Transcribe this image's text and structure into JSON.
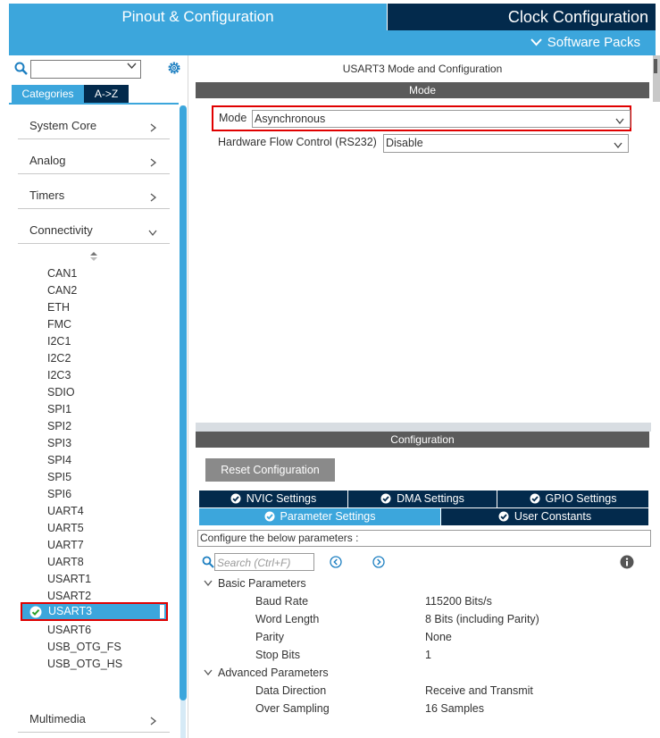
{
  "header": {
    "pinout_title": "Pinout & Configuration",
    "clock_title": "Clock Configuration",
    "software_packs": "Software Packs"
  },
  "sidebar": {
    "tabs": {
      "categories": "Categories",
      "az": "A->Z"
    },
    "categories": [
      "System Core",
      "Analog",
      "Timers",
      "Connectivity"
    ],
    "bottom_category": "Multimedia",
    "peripherals": [
      "CAN1",
      "CAN2",
      "ETH",
      "FMC",
      "I2C1",
      "I2C2",
      "I2C3",
      "SDIO",
      "SPI1",
      "SPI2",
      "SPI3",
      "SPI4",
      "SPI5",
      "SPI6",
      "UART4",
      "UART5",
      "UART7",
      "UART8",
      "USART1",
      "USART2"
    ],
    "selected_peripheral": "USART3",
    "peripherals_after": [
      "USART6",
      "USB_OTG_FS",
      "USB_OTG_HS"
    ]
  },
  "mode_panel": {
    "title": "USART3 Mode and Configuration",
    "header": "Mode",
    "mode_label": "Mode",
    "mode_value": "Asynchronous",
    "hfc_label": "Hardware Flow Control (RS232)",
    "hfc_value": "Disable"
  },
  "config_panel": {
    "header": "Configuration",
    "reset_button": "Reset Configuration",
    "tabs": {
      "nvic": "NVIC Settings",
      "dma": "DMA Settings",
      "gpio": "GPIO Settings",
      "parameter": "Parameter Settings",
      "user_constants": "User Constants"
    },
    "configure_text": "Configure the below parameters :",
    "search_placeholder": "Search (Ctrl+F)",
    "basic_group": "Basic Parameters",
    "basic_params": [
      {
        "name": "Baud Rate",
        "value": "115200 Bits/s"
      },
      {
        "name": "Word Length",
        "value": "8 Bits (including Parity)"
      },
      {
        "name": "Parity",
        "value": "None"
      },
      {
        "name": "Stop Bits",
        "value": "1"
      }
    ],
    "advanced_group": "Advanced Parameters",
    "advanced_params": [
      {
        "name": "Data Direction",
        "value": "Receive and Transmit"
      },
      {
        "name": "Over Sampling",
        "value": "16 Samples"
      }
    ]
  },
  "colors": {
    "accent_blue": "#3ca6dc",
    "dark_navy": "#032a4c",
    "section_gray": "#5b5b5b",
    "highlight_red": "#e00000"
  }
}
